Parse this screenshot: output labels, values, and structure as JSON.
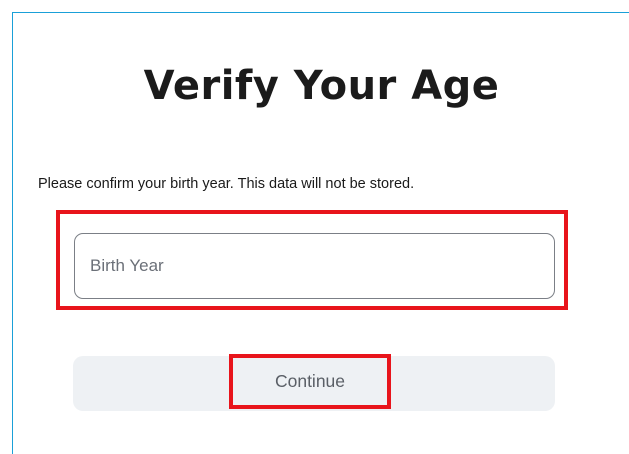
{
  "modal": {
    "title": "Verify Your Age",
    "description": "Please confirm your birth year. This data will not be stored.",
    "birth_year_input": {
      "value": "",
      "placeholder": "Birth Year"
    },
    "continue_label": "Continue"
  },
  "colors": {
    "highlight": "#e8141b",
    "modal_border": "#1aa0d8",
    "button_bg": "#eef1f4",
    "button_text": "#5a5f66",
    "title_text": "#1b1b1b"
  }
}
